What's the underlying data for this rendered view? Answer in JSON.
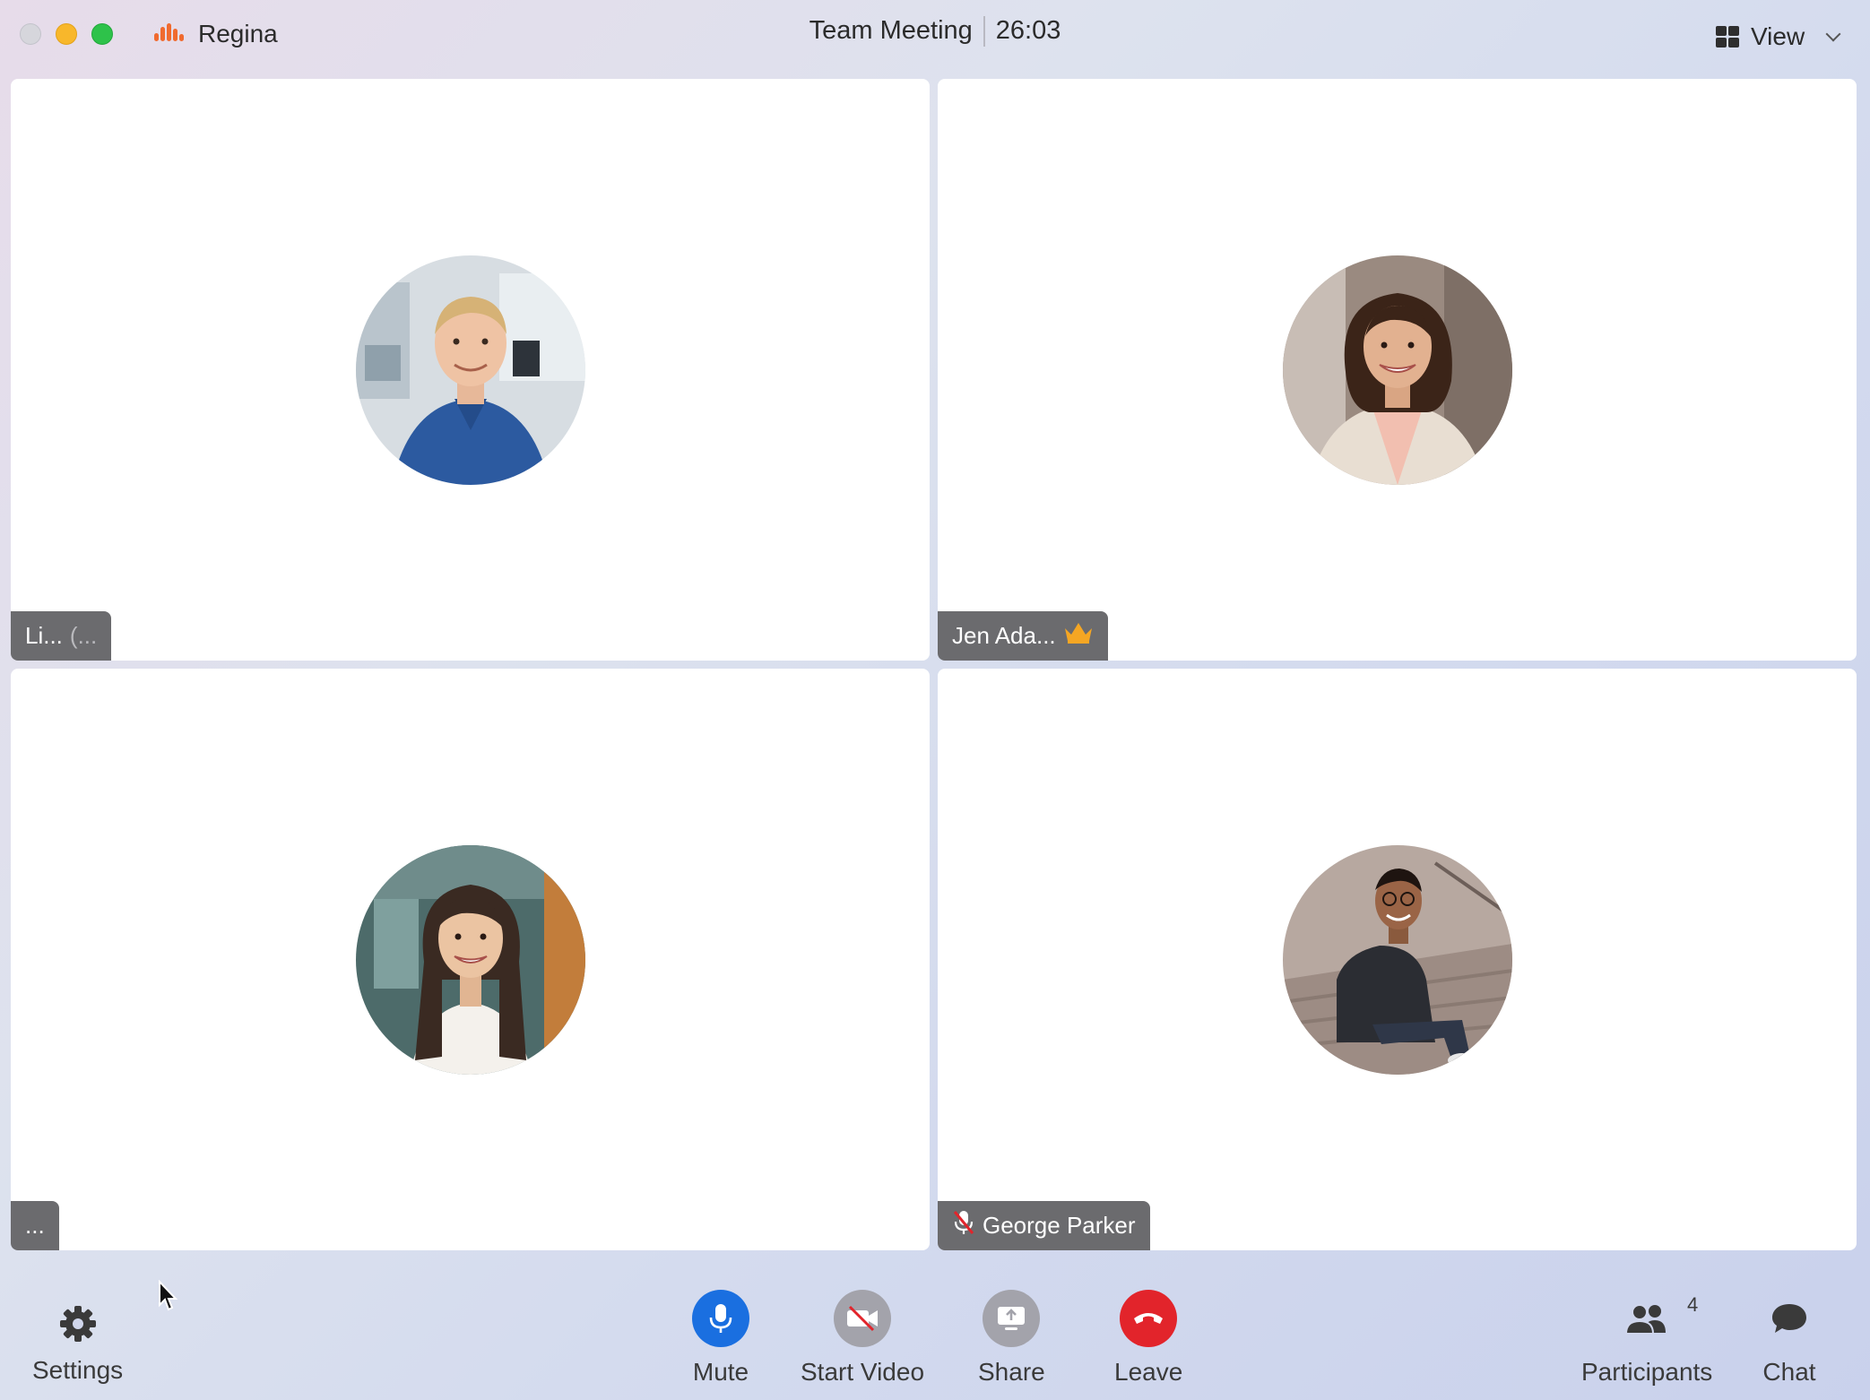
{
  "window": {
    "app_name": "Regina",
    "meeting_title": "Team Meeting",
    "timer": "26:03",
    "view_label": "View"
  },
  "tiles": [
    {
      "name": "Li...",
      "suffix": "(...",
      "host": false,
      "muted": false
    },
    {
      "name": "Jen Ada...",
      "suffix": "",
      "host": true,
      "muted": false
    },
    {
      "name": "...",
      "suffix": "",
      "host": false,
      "muted": false
    },
    {
      "name": "George Parker",
      "suffix": "",
      "host": false,
      "muted": true
    }
  ],
  "toolbar": {
    "settings_label": "Settings",
    "mute_label": "Mute",
    "start_video_label": "Start Video",
    "share_label": "Share",
    "leave_label": "Leave",
    "participants_label": "Participants",
    "participants_count": "4",
    "chat_label": "Chat"
  },
  "colors": {
    "accent_blue": "#1a6fe0",
    "leave_red": "#e2242b",
    "app_orange": "#f06a2f",
    "host_crown": "#f5a623"
  },
  "icons": {
    "app": "audio-bars-icon",
    "view": "grid-icon",
    "settings": "gear-icon",
    "mute": "microphone-icon",
    "video": "video-off-icon",
    "share": "share-screen-icon",
    "leave": "hang-up-icon",
    "participants": "people-icon",
    "chat": "chat-bubble-icon",
    "host": "crown-icon",
    "muted": "mic-off-icon"
  }
}
